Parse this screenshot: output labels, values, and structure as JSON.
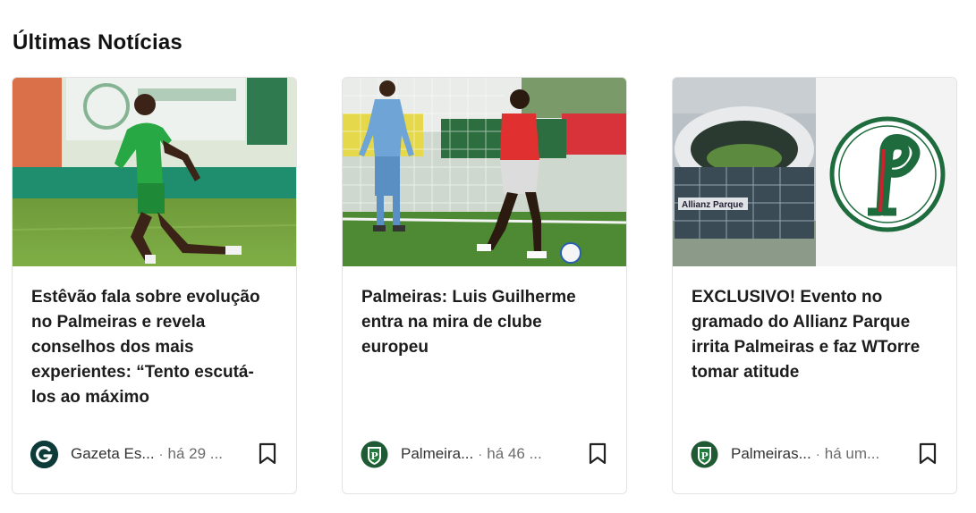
{
  "section": {
    "title": "Últimas Notícias"
  },
  "articles": [
    {
      "headline": "Estêvão fala sobre evolução no Palmeiras e revela conselhos dos mais experientes: “Tento escutá-los ao máximo",
      "source": "Gazeta Es...",
      "time": "há 29 ...",
      "source_icon": "gazeta-g-logo",
      "image": "player-green-kit-training"
    },
    {
      "headline": "Palmeiras: Luis Guilherme entra na mira de clube europeu",
      "source": "Palmeira...",
      "time": "há 46 ...",
      "source_icon": "palmeiras-crest",
      "image": "goalkeeper-and-player-training"
    },
    {
      "headline": "EXCLUSIVO! Evento no gramado do Allianz Parque irrita Palmeiras e faz WTorre tomar atitude",
      "source": "Palmeiras...",
      "time": "há um...",
      "source_icon": "palmeiras-crest",
      "image": "allianz-parque-stadium-and-crest"
    }
  ],
  "separator": "·",
  "colors": {
    "palmeiras_green": "#006437",
    "gazeta_dark": "#0d3b3a",
    "text": "#1c1c1c",
    "muted": "#6b6b6b"
  }
}
